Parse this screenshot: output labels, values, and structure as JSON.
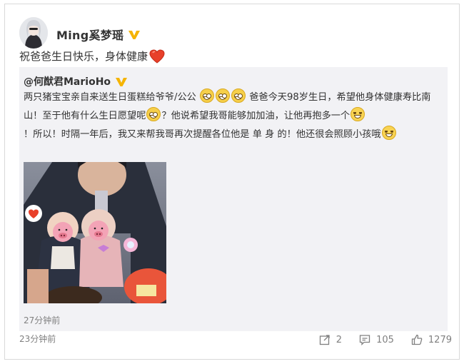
{
  "post": {
    "author": "Ming奚梦瑶",
    "text": "祝爸爸生日快乐，身体健康",
    "time": "23分钟前"
  },
  "repost": {
    "author_prefix": "@",
    "author": "何猷君MarioHo",
    "segments": {
      "s1": "两只猪宝宝亲自来送生日蛋糕给爷爷/公公",
      "s2": "爸爸今天98岁生日，希望他身体健康寿比南山！至于他有什么生日愿望呢",
      "s3": "？他说希望我哥能够加加油，让他再抱多一个",
      "s4": "！所以！时隔一年后，我又来帮我哥再次提醒各位他是 单 身 的！他还很会照顾小孩哦"
    },
    "time": "27分钟前"
  },
  "actions": {
    "repost_count": "2",
    "comment_count": "105",
    "like_count": "1279"
  },
  "colors": {
    "verified": "#f5b400",
    "repost_bg": "#f2f2f5",
    "heart": "#e8402a",
    "pig": "#f3a3b6"
  }
}
